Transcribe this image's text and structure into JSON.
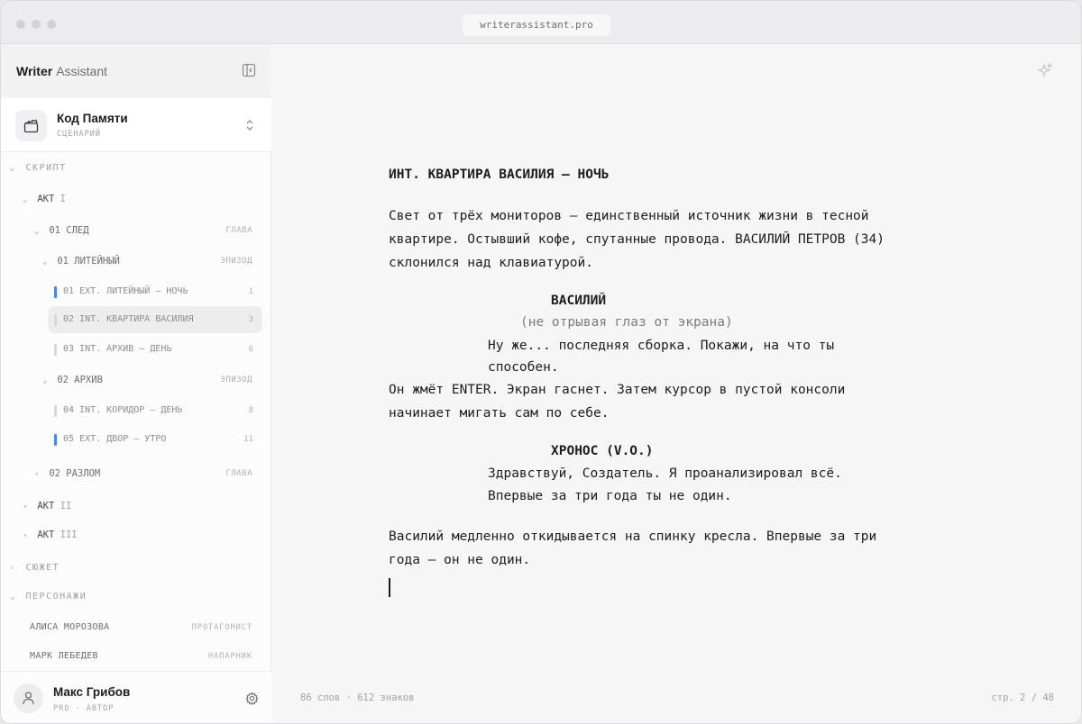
{
  "browser": {
    "url": "writerassistant.pro"
  },
  "sidebar": {
    "brand_primary": "Writer",
    "brand_secondary": "Assistant",
    "project": {
      "title": "Код Памяти",
      "type": "СЦЕНАРИЙ"
    },
    "section_script": "СКРИПТ",
    "act1": {
      "label": "АКТ",
      "num": "I"
    },
    "chapter1": {
      "label": "01 СЛЕД",
      "meta": "ГЛАВА"
    },
    "episode1": {
      "label": "01 ЛИТЕЙНЫЙ",
      "meta": "ЭПИЗОД"
    },
    "scenes_ep1": [
      {
        "label": "01 EXT. ЛИТЕЙНЫЙ — НОЧЬ",
        "count": "1",
        "marker": "blue"
      },
      {
        "label": "02 INT. КВАРТИРА ВАСИЛИЯ",
        "count": "3",
        "marker": "gray",
        "active": true
      },
      {
        "label": "03 INT. АРХИВ — ДЕНЬ",
        "count": "6",
        "marker": "gray"
      }
    ],
    "episode2": {
      "label": "02 АРХИВ",
      "meta": "ЭПИЗОД"
    },
    "scenes_ep2": [
      {
        "label": "04 INT. КОРИДОР — ДЕНЬ",
        "count": "8",
        "marker": "gray"
      },
      {
        "label": "05 EXT. ДВОР — УТРО",
        "count": "11",
        "marker": "blue"
      }
    ],
    "chapter2": {
      "label": "02 РАЗЛОМ",
      "meta": "ГЛАВА"
    },
    "act2": {
      "label": "АКТ",
      "num": "II"
    },
    "act3": {
      "label": "АКТ",
      "num": "III"
    },
    "section_plot": "СЮЖЕТ",
    "section_characters": "ПЕРСОНАЖИ",
    "characters": [
      {
        "name": "АЛИСА МОРОЗОВА",
        "role": "ПРОТАГОНИСТ"
      },
      {
        "name": "МАРК ЛЕБЕДЕВ",
        "role": "НАПАРНИК"
      }
    ],
    "user": {
      "name": "Макс Грибов",
      "plan": "PRO · АВТОР"
    }
  },
  "editor": {
    "slugline": "ИНТ. КВАРТИРА ВАСИЛИЯ — НОЧЬ",
    "action1": [
      "Свет от трёх мониторов — единственный источник жизни в тесной",
      "квартире. Остывший кофе, спутанные провода. ВАСИЛИЙ ПЕТРОВ (34)",
      "склонился над клавиатурой."
    ],
    "char1": "ВАСИЛИЙ",
    "paren1": "(не отрывая глаз от экрана)",
    "dialogue1": [
      "Ну же... последняя сборка. Покажи, на что ты",
      "способен."
    ],
    "action2": [
      "Он жмёт ENTER. Экран гаснет. Затем курсор в пустой консоли",
      "начинает мигать сам по себе."
    ],
    "char2": "ХРОНОС (V.O.)",
    "dialogue2": [
      "Здравствуй, Создатель. Я проанализировал всё.",
      "Впервые за три года ты не один."
    ],
    "action3": [
      "Василий медленно откидывается на спинку кресла. Впервые за три",
      "года — он не один."
    ],
    "stats": "86 слов · 612 знаков",
    "page": "стр. 2 / 48"
  },
  "colors": {
    "accent": "#4a83f0",
    "active_bg": "#ededee"
  }
}
